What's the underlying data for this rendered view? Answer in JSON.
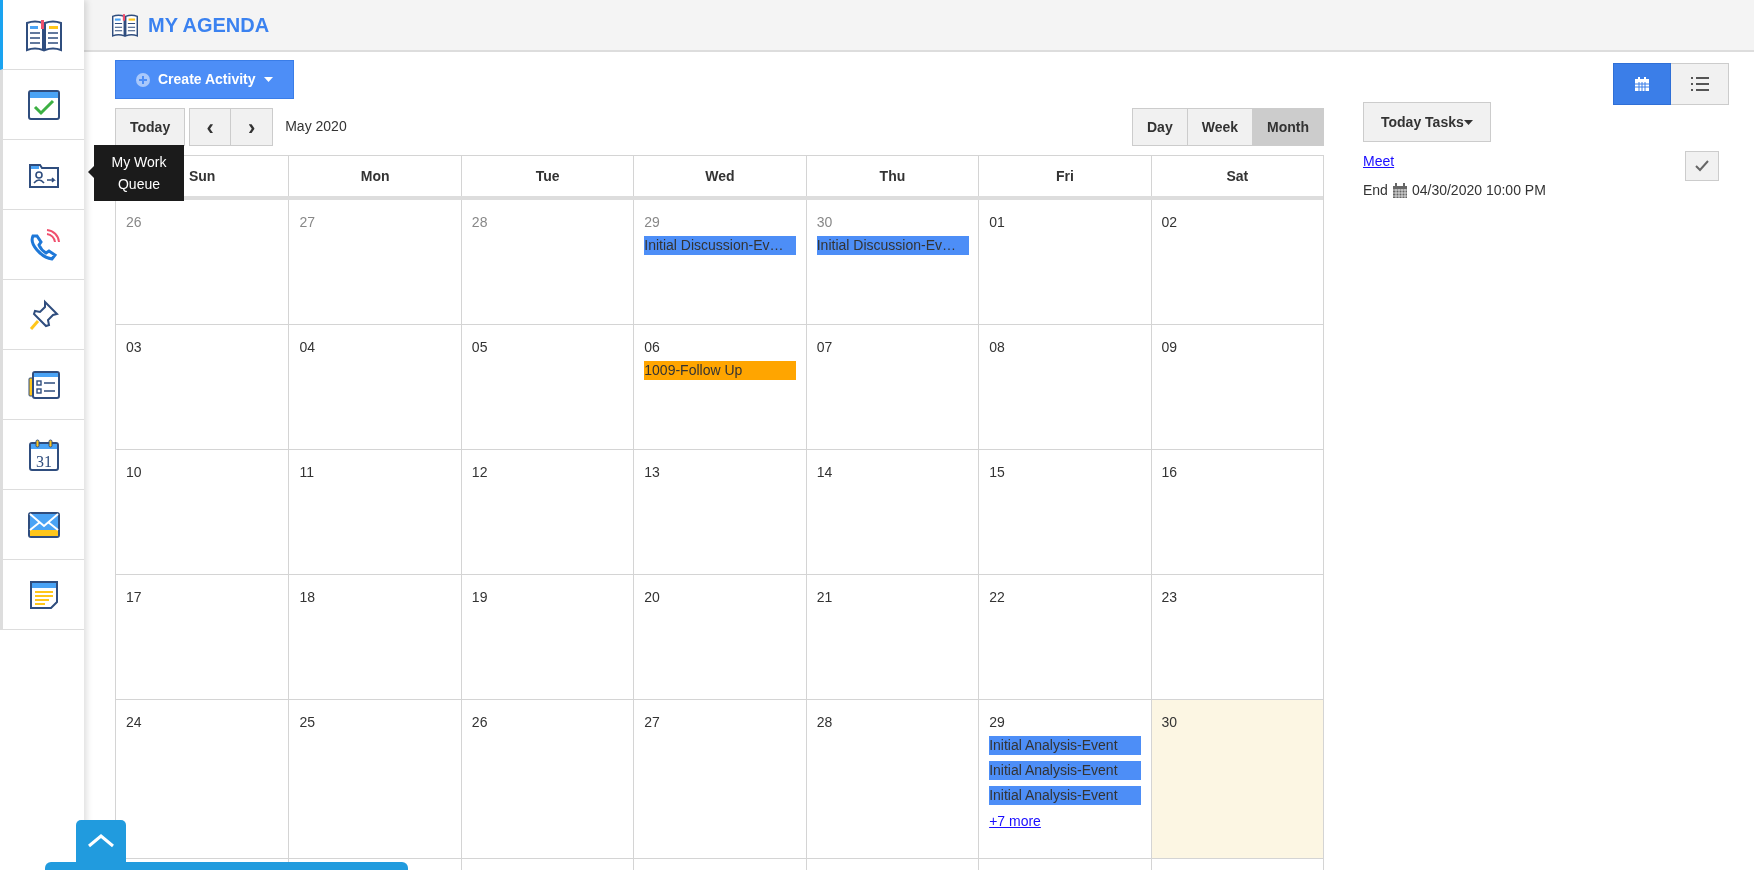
{
  "sidebar": {
    "items": [
      {
        "selected": true
      },
      {
        "selected": false
      },
      {
        "selected": false
      },
      {
        "selected": false
      },
      {
        "selected": false
      },
      {
        "selected": false
      },
      {
        "selected": false,
        "icon_text": "31"
      },
      {
        "selected": false
      },
      {
        "selected": false
      }
    ],
    "tooltip": "My Work Queue"
  },
  "header": {
    "title": "MY AGENDA"
  },
  "toolbar": {
    "create_button": "Create Activity",
    "view_modes": [
      {
        "kind": "calendar",
        "selected": true
      },
      {
        "kind": "list",
        "selected": false
      }
    ]
  },
  "calendar": {
    "today_button": "Today",
    "prev": "‹",
    "next": "›",
    "period": "May 2020",
    "ranges": [
      {
        "label": "Day",
        "selected": false
      },
      {
        "label": "Week",
        "selected": false
      },
      {
        "label": "Month",
        "selected": true
      }
    ],
    "weekdays": [
      "Sun",
      "Mon",
      "Tue",
      "Wed",
      "Thu",
      "Fri",
      "Sat"
    ],
    "weeks": [
      [
        {
          "label": "26",
          "other_month": true
        },
        {
          "label": "27",
          "other_month": true
        },
        {
          "label": "28",
          "other_month": true
        },
        {
          "label": "29",
          "other_month": true,
          "events": [
            {
              "title": "Initial Discussion-Ev…",
              "color": "#4d8ef7"
            }
          ]
        },
        {
          "label": "30",
          "other_month": true,
          "events": [
            {
              "title": "Initial Discussion-Ev…",
              "color": "#4d8ef7"
            }
          ]
        },
        {
          "label": "01"
        },
        {
          "label": "02"
        }
      ],
      [
        {
          "label": "03"
        },
        {
          "label": "04"
        },
        {
          "label": "05"
        },
        {
          "label": "06",
          "events": [
            {
              "title": "1009-Follow Up",
              "color": "#ffa500"
            }
          ]
        },
        {
          "label": "07"
        },
        {
          "label": "08"
        },
        {
          "label": "09"
        }
      ],
      [
        {
          "label": "10"
        },
        {
          "label": "11"
        },
        {
          "label": "12"
        },
        {
          "label": "13"
        },
        {
          "label": "14"
        },
        {
          "label": "15"
        },
        {
          "label": "16"
        }
      ],
      [
        {
          "label": "17"
        },
        {
          "label": "18"
        },
        {
          "label": "19"
        },
        {
          "label": "20"
        },
        {
          "label": "21"
        },
        {
          "label": "22"
        },
        {
          "label": "23"
        }
      ],
      [
        {
          "label": "24"
        },
        {
          "label": "25"
        },
        {
          "label": "26"
        },
        {
          "label": "27"
        },
        {
          "label": "28"
        },
        {
          "label": "29",
          "events": [
            {
              "title": "Initial Analysis-Event",
              "color": "#4d8ef7"
            },
            {
              "title": "Initial Analysis-Event",
              "color": "#4d8ef7"
            },
            {
              "title": "Initial Analysis-Event",
              "color": "#4d8ef7"
            }
          ],
          "more": "+7 more"
        },
        {
          "label": "30",
          "today": true
        }
      ]
    ]
  },
  "tasks": {
    "dropdown": "Today Tasks",
    "items": [
      {
        "title": "Meet",
        "end_label": "End",
        "end": "04/30/2020 10:00 PM",
        "done": false
      }
    ]
  }
}
